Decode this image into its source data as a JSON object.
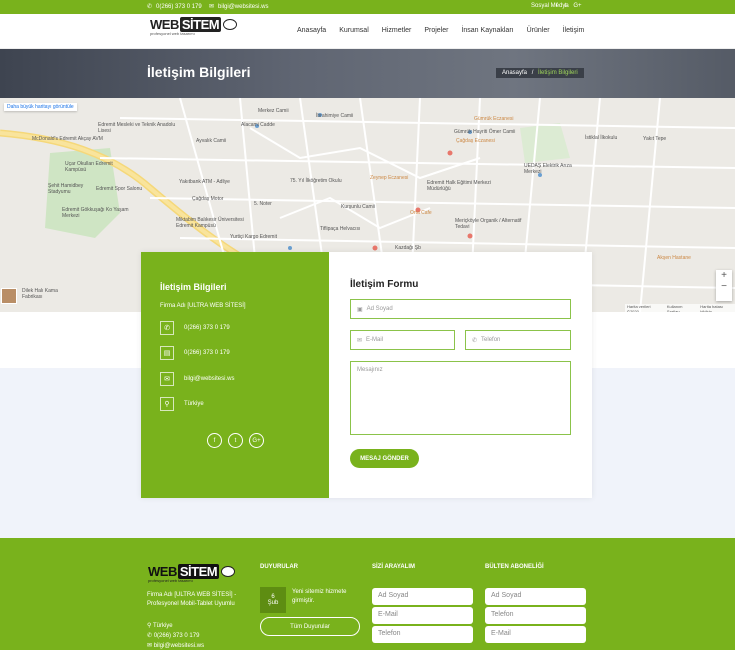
{
  "topbar": {
    "phone": "0(266) 373 0 179",
    "email": "bilgi@websitesi.ws",
    "social_label": "Sosyal Medya",
    "social_icons": [
      "facebook-icon",
      "twitter-icon",
      "google-plus-icon"
    ]
  },
  "logo": {
    "word1": "WEB",
    "word2": "SİTEM",
    "tagline": "profesyonel web tasarımı"
  },
  "nav": [
    "Anasayfa",
    "Kurumsal",
    "Hizmetler",
    "Projeler",
    "İnsan Kaynakları",
    "Ürünler",
    "İletişim"
  ],
  "hero": {
    "title": "İletişim Bilgileri",
    "crumb_home": "Anasayfa",
    "crumb_sep": "/",
    "crumb_current": "İletişim Bilgileri"
  },
  "map": {
    "larger_map_link": "Daha büyük haritayı görüntüle",
    "zoom_in": "+",
    "zoom_out": "−",
    "attribution": [
      "Harita verileri ©2020",
      "Kullanım Şartları",
      "Harita hatası bildirin"
    ],
    "labels": [
      "Merkez Camii",
      "İbrahimiye Camii",
      "Alacami Cadde",
      "Ayvalık Camii",
      "Gümrük Hayriti Ömer Camii",
      "Gümrük Eczanesi",
      "Çağdaş Eczanesi",
      "İstiklal İlkokulu",
      "Yakıt Tepe",
      "Edremit Mesleki ve Teknik Anadolu Lisesi",
      "McDonald's Edremit Akçay AVM",
      "Uçar Okulları Edremit Kampüsü",
      "Şehit Hamidbey Stadyumu",
      "Edremit Spor Salonu",
      "Edremit Gökkuşağı Ko Yaşam Merkezi",
      "Yakıtbank ATM - Adliye",
      "75. Yıl İlköğretim Okulu",
      "Zeynep Eczanesi",
      "Edremit Halk Eğitimi Merkezi Müdürlüğü",
      "UEDAŞ Elektrik Arıza Merkezi",
      "Çağdaş Motor",
      "5. Noter",
      "Kurşunlu Camii",
      "Orta Cafe",
      "Meriçköyle Organik / Alternatif Tedavi",
      "Miktabim Balıkesir Üniversitesi Edremit Kampüsü",
      "Tiflipaça Helvacısı",
      "Kazdağı Şb",
      "Yurtiçi Kargo Edremit",
      "Dilek Halı Kama Fabrikası",
      "Akşen Hastane"
    ]
  },
  "info": {
    "title": "İletişim Bilgileri",
    "firm": "Firma Adı [ULTRA WEB SİTESİ]",
    "phone": "0(266) 373 0 179",
    "fax": "0(266) 373 0 179",
    "email": "bilgi@websitesi.ws",
    "location": "Türkiye"
  },
  "form": {
    "title": "İletişim Formu",
    "name_ph": "Ad Soyad",
    "email_ph": "E-Mail",
    "phone_ph": "Telefon",
    "message_ph": "Mesajınız",
    "send": "MESAJ GÖNDER"
  },
  "footer": {
    "firm": "Firma Adı [ULTRA WEB SİTESİ] - Profesyonel Mobil-Tablet Uyumlu",
    "location": "Türkiye",
    "phone": "0(266) 373 0 179",
    "email": "bilgi@websitesi.ws",
    "news_title": "DUYURULAR",
    "news_day": "6",
    "news_month": "Şub",
    "news_text": "Yeni sitemiz hizmete girmiştir.",
    "news_all": "Tüm Duyurular",
    "callback_title": "SİZİ ARAYALIM",
    "callback_name": "Ad Soyad",
    "callback_email": "E-Mail",
    "callback_phone": "Telefon",
    "newsletter_title": "BÜLTEN ABONELİĞİ",
    "nl_name": "Ad Soyad",
    "nl_phone": "Telefon",
    "nl_email": "E-Mail"
  },
  "colors": {
    "accent": "#79b21c",
    "accent_light": "#8bc34a",
    "hero": "#5b616c"
  }
}
